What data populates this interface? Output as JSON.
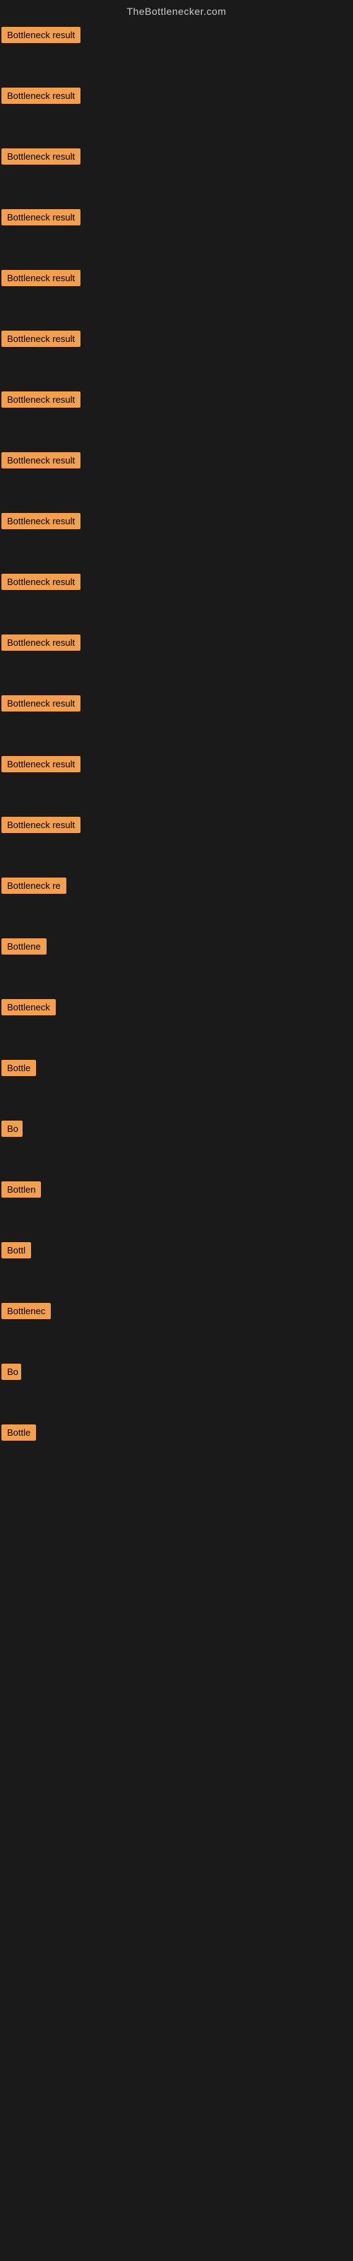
{
  "site": {
    "title": "TheBottlenecker.com"
  },
  "rows": [
    {
      "id": 1,
      "label": "Bottleneck result",
      "width": 160
    },
    {
      "id": 2,
      "label": "Bottleneck result",
      "width": 160
    },
    {
      "id": 3,
      "label": "Bottleneck result",
      "width": 160
    },
    {
      "id": 4,
      "label": "Bottleneck result",
      "width": 160
    },
    {
      "id": 5,
      "label": "Bottleneck result",
      "width": 160
    },
    {
      "id": 6,
      "label": "Bottleneck result",
      "width": 160
    },
    {
      "id": 7,
      "label": "Bottleneck result",
      "width": 160
    },
    {
      "id": 8,
      "label": "Bottleneck result",
      "width": 160
    },
    {
      "id": 9,
      "label": "Bottleneck result",
      "width": 160
    },
    {
      "id": 10,
      "label": "Bottleneck result",
      "width": 160
    },
    {
      "id": 11,
      "label": "Bottleneck result",
      "width": 160
    },
    {
      "id": 12,
      "label": "Bottleneck result",
      "width": 155
    },
    {
      "id": 13,
      "label": "Bottleneck result",
      "width": 150
    },
    {
      "id": 14,
      "label": "Bottleneck result",
      "width": 145
    },
    {
      "id": 15,
      "label": "Bottleneck re",
      "width": 110
    },
    {
      "id": 16,
      "label": "Bottlene",
      "width": 80
    },
    {
      "id": 17,
      "label": "Bottleneck",
      "width": 88
    },
    {
      "id": 18,
      "label": "Bottle",
      "width": 60
    },
    {
      "id": 19,
      "label": "Bo",
      "width": 30
    },
    {
      "id": 20,
      "label": "Bottlen",
      "width": 68
    },
    {
      "id": 21,
      "label": "Bottl",
      "width": 52
    },
    {
      "id": 22,
      "label": "Bottlenec",
      "width": 84
    },
    {
      "id": 23,
      "label": "Bo",
      "width": 28
    },
    {
      "id": 24,
      "label": "Bottle",
      "width": 58
    }
  ]
}
